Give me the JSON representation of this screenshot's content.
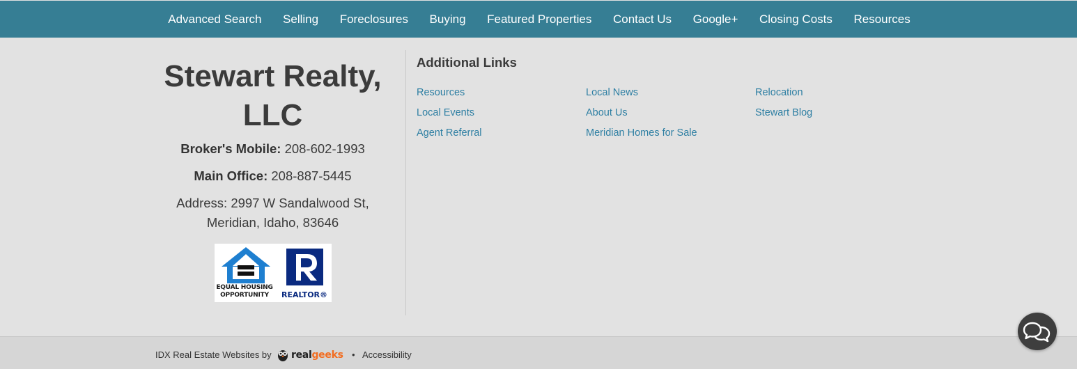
{
  "nav": {
    "items": [
      "Advanced Search",
      "Selling",
      "Foreclosures",
      "Buying",
      "Featured Properties",
      "Contact Us",
      "Google+",
      "Closing Costs",
      "Resources"
    ]
  },
  "company": {
    "name": "Stewart Realty, LLC",
    "mobile_label": "Broker's Mobile:",
    "mobile_value": "208-602-1993",
    "office_label": "Main Office:",
    "office_value": "208-887-5445",
    "address_line1": "Address: 2997 W Sandalwood St,",
    "address_line2": "Meridian, Idaho, 83646"
  },
  "badges": {
    "eho_line1": "EQUAL HOUSING",
    "eho_line2": "OPPORTUNITY",
    "realtor": "REALTOR®"
  },
  "links": {
    "heading": "Additional Links",
    "col1": [
      "Resources",
      "Local Events",
      "Agent Referral"
    ],
    "col2": [
      "Local News",
      "About Us",
      "Meridian Homes for Sale"
    ],
    "col3": [
      "Relocation",
      "Stewart Blog"
    ]
  },
  "footer": {
    "idx_text": "IDX Real Estate Websites by",
    "brand_real": "real",
    "brand_geeks": "geeks",
    "separator": "•",
    "accessibility": "Accessibility"
  },
  "colors": {
    "nav_bg": "#367e94",
    "link": "#2e7fa3",
    "brand_orange": "#f26d21",
    "chat_bg": "#3e3e3e"
  },
  "icons": {
    "chat": "chat-bubbles-icon",
    "eho": "equal-housing-icon",
    "realtor": "realtor-r-icon",
    "brand": "realgeeks-owl-icon"
  }
}
